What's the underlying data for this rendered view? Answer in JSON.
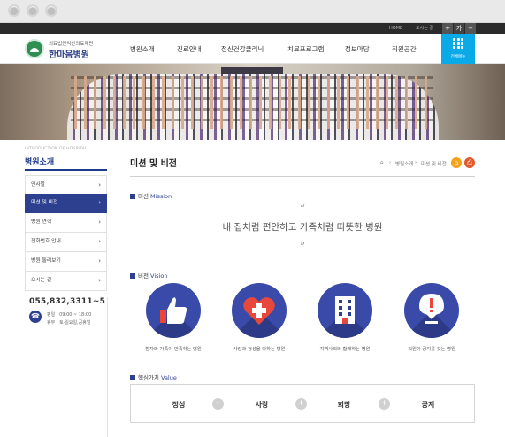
{
  "utility": {
    "home": "HOME",
    "sitemap": "오시는 길",
    "zoom_in": "+",
    "zoom_reset": "가",
    "zoom_out": "−"
  },
  "logo": {
    "subtitle": "의료법인익산의료재단",
    "name": "한마음병원"
  },
  "gnb": [
    "병원소개",
    "진료안내",
    "정신건강클리닉",
    "치료프로그램",
    "정보마당",
    "직원공간"
  ],
  "allmenu": {
    "label": "전체메뉴"
  },
  "sidebar": {
    "caption": "INTRODUCTION OF HOSPITAL",
    "title": "병원소개",
    "items": [
      {
        "label": "인사말",
        "active": false
      },
      {
        "label": "미션 및 비전",
        "active": true
      },
      {
        "label": "병원 연혁",
        "active": false
      },
      {
        "label": "전화번호 안내",
        "active": false
      },
      {
        "label": "병원 둘러보기",
        "active": false
      },
      {
        "label": "오시는 길",
        "active": false
      }
    ],
    "arrow": "›",
    "phone": "055,832,3311~5",
    "hours_weekday": "평일 : 09:00 ~ 18:00",
    "hours_holiday": "휴무 : 토·일요일,공휴일"
  },
  "page": {
    "title": "미션 및 비전"
  },
  "breadcrumb": {
    "level1": "병원소개",
    "sep": "›",
    "level2": "미션 및 비전"
  },
  "mission": {
    "heading": "미션",
    "heading_en": "Mission",
    "quote_open": "“",
    "quote_close": "”",
    "text": "내 집처럼 편안하고 가족처럼 따뜻한 병원"
  },
  "vision": {
    "heading": "비전",
    "heading_en": "Vision",
    "items": [
      {
        "caption": "환자와 가족이 만족하는 병원",
        "icon": "thumbs-up-icon"
      },
      {
        "caption": "사랑과 정성을 다하는 병원",
        "icon": "heart-cross-icon"
      },
      {
        "caption": "지역사회와 함께하는 병원",
        "icon": "building-icon"
      },
      {
        "caption": "직원이 긍지를 갖는 병원",
        "icon": "exclamation-badge-icon"
      }
    ]
  },
  "core": {
    "heading": "핵심가치",
    "heading_en": "Value",
    "values": [
      "정성",
      "사랑",
      "희망",
      "긍지"
    ],
    "plus": "+"
  },
  "colors": {
    "navy": "#2d3f8f",
    "accent": "#0aa9e8",
    "home_btn": "#f5a21b",
    "print_btn": "#e05a2b",
    "icon_red": "#e8473b"
  }
}
